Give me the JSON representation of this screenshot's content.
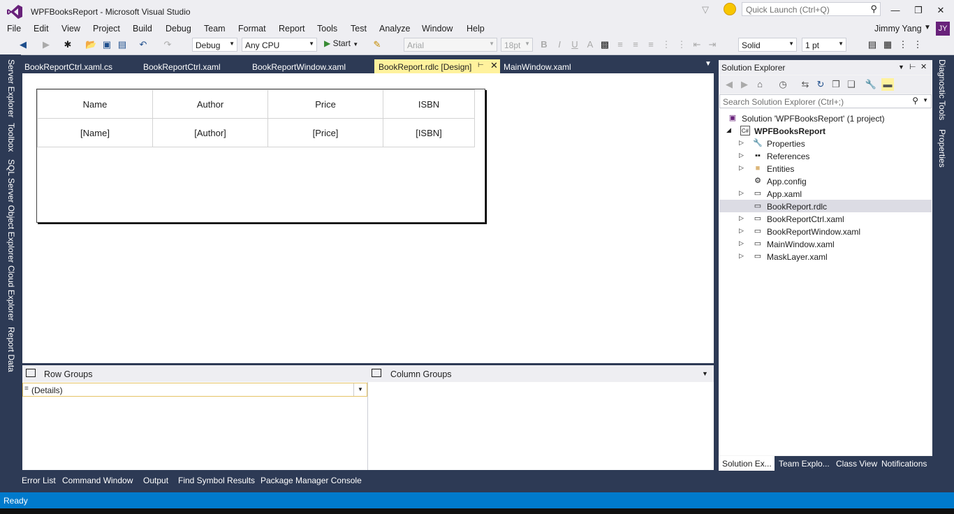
{
  "window": {
    "title": "WPFBooksReport - Microsoft Visual Studio",
    "quick_launch_placeholder": "Quick Launch (Ctrl+Q)",
    "user_name": "Jimmy Yang",
    "user_initials": "JY"
  },
  "menu": [
    "File",
    "Edit",
    "View",
    "Project",
    "Build",
    "Debug",
    "Team",
    "Format",
    "Report",
    "Tools",
    "Test",
    "Analyze",
    "Window",
    "Help"
  ],
  "toolbar": {
    "config": "Debug",
    "platform": "Any CPU",
    "start_label": "Start",
    "font_name": "Arial",
    "font_size": "18pt",
    "border_style": "Solid",
    "border_width": "1 pt"
  },
  "left_tabs": [
    "Server Explorer",
    "Toolbox",
    "SQL Server Object Explorer",
    "Cloud Explorer",
    "Report Data"
  ],
  "doc_tabs": [
    "BookReportCtrl.xaml.cs",
    "BookReportCtrl.xaml",
    "BookReportWindow.xaml",
    "BookReport.rdlc [Design]",
    "MainWindow.xaml"
  ],
  "report": {
    "headers": [
      "Name",
      "Author",
      "Price",
      "ISBN"
    ],
    "fields": [
      "[Name]",
      "[Author]",
      "[Price]",
      "[ISBN]"
    ]
  },
  "groups": {
    "row_label": "Row Groups",
    "col_label": "Column Groups",
    "details": "(Details)"
  },
  "solution_explorer": {
    "title": "Solution Explorer",
    "search_placeholder": "Search Solution Explorer (Ctrl+;)",
    "items": [
      {
        "label": "Solution 'WPFBooksReport' (1 project)"
      },
      {
        "label": "WPFBooksReport"
      },
      {
        "label": "Properties"
      },
      {
        "label": "References"
      },
      {
        "label": "Entities"
      },
      {
        "label": "App.config"
      },
      {
        "label": "App.xaml"
      },
      {
        "label": "BookReport.rdlc"
      },
      {
        "label": "BookReportCtrl.xaml"
      },
      {
        "label": "BookReportWindow.xaml"
      },
      {
        "label": "MainWindow.xaml"
      },
      {
        "label": "MaskLayer.xaml"
      }
    ],
    "tabs": [
      "Solution Ex...",
      "Team Explo...",
      "Class View",
      "Notifications"
    ]
  },
  "right_tabs": [
    "Diagnostic Tools",
    "Properties"
  ],
  "bottom_tabs": [
    "Error List",
    "Command Window",
    "Output",
    "Find Symbol Results",
    "Package Manager Console"
  ],
  "status": {
    "text": "Ready"
  },
  "colors": {
    "accent": "#007acc",
    "active_tab": "#fff29d",
    "frame": "#2d3a55",
    "vs_purple": "#68217a"
  }
}
